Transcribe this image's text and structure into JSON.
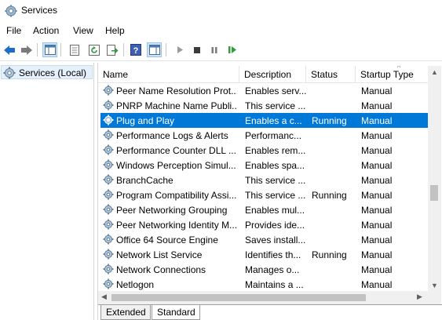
{
  "window": {
    "title": "Services",
    "icon": "services-gear-icon"
  },
  "menu": [
    "File",
    "Action",
    "View",
    "Help"
  ],
  "toolbar": {
    "buttons": [
      "back-arrow-icon",
      "forward-arrow-icon",
      "show-console-tree-icon",
      "properties-icon",
      "refresh-icon",
      "export-list-icon",
      "help-icon",
      "show-action-pane-icon",
      "start-service-icon",
      "stop-service-icon",
      "pause-service-icon",
      "resume-service-icon"
    ]
  },
  "tree": {
    "root_label": "Services (Local)"
  },
  "columns": {
    "name": "Name",
    "description": "Description",
    "status": "Status",
    "startup_type": "Startup Type"
  },
  "services": [
    {
      "name": "Peer Name Resolution Prot...",
      "description": "Enables serv...",
      "status": "",
      "startup": "Manual"
    },
    {
      "name": "PNRP Machine Name Publi...",
      "description": "This service ...",
      "status": "",
      "startup": "Manual"
    },
    {
      "name": "Plug and Play",
      "description": "Enables a c...",
      "status": "Running",
      "startup": "Manual",
      "selected": true
    },
    {
      "name": "Performance Logs & Alerts",
      "description": "Performanc...",
      "status": "",
      "startup": "Manual"
    },
    {
      "name": "Performance Counter DLL ...",
      "description": "Enables rem...",
      "status": "",
      "startup": "Manual"
    },
    {
      "name": "Windows Perception Simul...",
      "description": "Enables spa...",
      "status": "",
      "startup": "Manual"
    },
    {
      "name": "BranchCache",
      "description": "This service ...",
      "status": "",
      "startup": "Manual"
    },
    {
      "name": "Program Compatibility Assi...",
      "description": "This service ...",
      "status": "Running",
      "startup": "Manual"
    },
    {
      "name": "Peer Networking Grouping",
      "description": "Enables mul...",
      "status": "",
      "startup": "Manual"
    },
    {
      "name": "Peer Networking Identity M...",
      "description": "Provides ide...",
      "status": "",
      "startup": "Manual"
    },
    {
      "name": "Office 64 Source Engine",
      "description": "Saves install...",
      "status": "",
      "startup": "Manual"
    },
    {
      "name": "Network List Service",
      "description": "Identifies th...",
      "status": "Running",
      "startup": "Manual"
    },
    {
      "name": "Network Connections",
      "description": "Manages o...",
      "status": "",
      "startup": "Manual"
    },
    {
      "name": "Netlogon",
      "description": "Maintains a ...",
      "status": "",
      "startup": "Manual"
    }
  ],
  "tabs": {
    "extended": "Extended",
    "standard": "Standard",
    "active": "Standard"
  },
  "colors": {
    "selection": "#0078d7",
    "accent_blue": "#1a6fc9",
    "play_green": "#2e9d3a"
  }
}
